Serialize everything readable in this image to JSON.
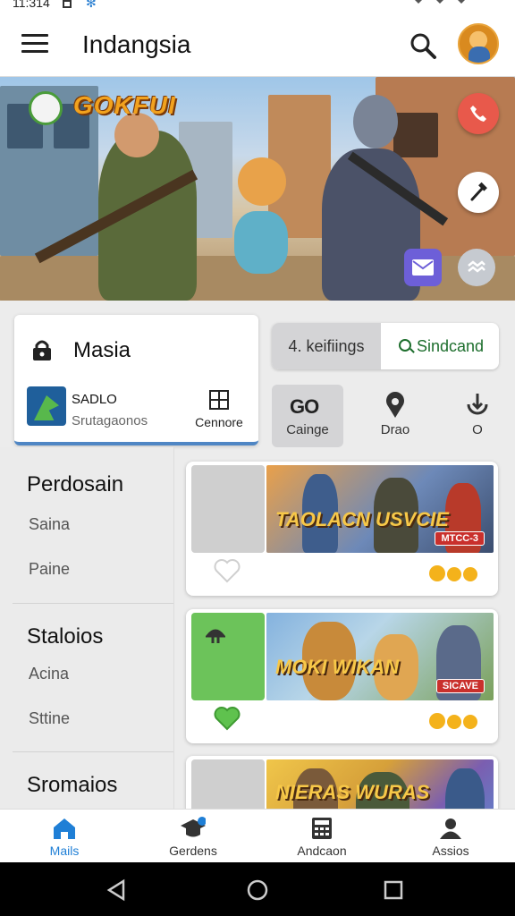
{
  "status_bar": {
    "time": "11:314"
  },
  "app_bar": {
    "title": "Indangsia"
  },
  "hero": {
    "title": "GOKFUI"
  },
  "profile_card": {
    "title": "Masia",
    "name": "SADLO",
    "subtitle": "Srutagaonos",
    "grid_label": "Cennore"
  },
  "segment": {
    "left": "4. keifiings",
    "right": "Sindcand"
  },
  "quick_actions": [
    {
      "icon_text": "GO",
      "label": "Cainge"
    },
    {
      "label": "Drao"
    },
    {
      "label": "O"
    }
  ],
  "sidebar": {
    "sections": [
      {
        "title": "Perdosain",
        "items": [
          "Saina",
          "Paine"
        ]
      },
      {
        "title": "Staloios",
        "items": [
          "Acina",
          "Sttine"
        ]
      },
      {
        "title": "Sromaios",
        "items": []
      }
    ]
  },
  "cards": [
    {
      "art_title": "TAOLACN USVCIE",
      "badge": "MTCC-3"
    },
    {
      "art_title": "MOKI WIKAN",
      "badge": "SICAVE"
    },
    {
      "art_title": "NIERAS WURAS",
      "badge": ""
    }
  ],
  "bottom_nav": [
    "Mails",
    "Gerdens",
    "Andcaon",
    "Assios"
  ],
  "colors": {
    "accent": "#1f7fd6",
    "call": "#e8594b",
    "mail": "#6d5fd8",
    "green": "#1d6e2d"
  }
}
